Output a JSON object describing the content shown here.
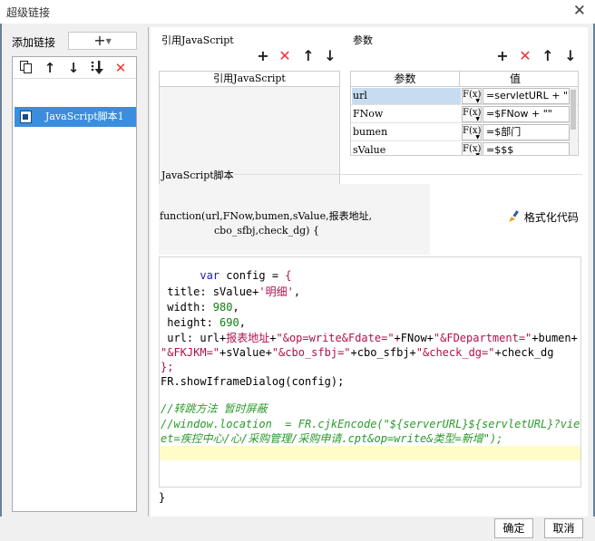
{
  "window": {
    "title": "超级链接",
    "close_glyph": "✕"
  },
  "left": {
    "add_link_label": "添加链接",
    "add_button_glyph": "+",
    "toolbar": [
      "copy-icon",
      "arrow-up-icon",
      "arrow-down-icon",
      "sort-down-icon",
      "delete-icon"
    ],
    "items": [
      {
        "label": "JavaScript脚本1",
        "icon": "script-icon"
      }
    ]
  },
  "ref_js": {
    "section_label": "引用JavaScript",
    "column_header": "引用JavaScript"
  },
  "params": {
    "section_label": "参数",
    "columns": [
      "参数",
      "值"
    ],
    "fx_label": "F(x)",
    "rows": [
      {
        "name": "url",
        "value": "=servletURL + \"?"
      },
      {
        "name": "FNow",
        "value": "=$FNow + \"\""
      },
      {
        "name": "bumen",
        "value": "=$部门"
      },
      {
        "name": "sValue",
        "value": "=$$$"
      }
    ]
  },
  "script": {
    "section_label": "JavaScript脚本",
    "signature_line1": "function(url,FNow,bumen,sValue,报表地址,",
    "signature_line2": "cbo_sfbj,check_dg) {",
    "format_button": "格式化代码",
    "code": {
      "l1_indent": "      ",
      "l1_kw": "var",
      "l1_rest": " config = ",
      "l1_brace": "{",
      "l2_a": " title: sValue+",
      "l2_s": "'明细'",
      "l2_b": ",",
      "l3_a": " width: ",
      "l3_n": "980",
      "l3_b": ",",
      "l4_a": " height: ",
      "l4_n": "690",
      "l4_b": ",",
      "l5_a": " url: url+",
      "l5_b": "报表地址",
      "l5_c": "+",
      "l5_s1": "\"&op=write&Fdate=\"",
      "l5_d": "+FNow+",
      "l5_s2": "\"&FDepartment=\"",
      "l5_e": "+bumen+",
      "l6_s1": "\"&FKJKM=\"",
      "l6_a": "+sValue+",
      "l6_s2": "\"&cbo_sfbj=\"",
      "l6_b": "+cbo_sfbj+",
      "l6_s3": "\"&check_dg=\"",
      "l6_c": "+check_dg",
      "l7": "};",
      "l8_a": "FR.showIframeDialog",
      "l8_b": "(config);",
      "c1": "//转跳方法 暂时屏蔽",
      "c2": "//window.location  = FR.cjkEncode(\"${serverURL}${servletURL}?viewl",
      "c3": "et=疾控中心/心/采购管理/采购申请.cpt&op=write&类型=新增\");",
      "closing": "}"
    }
  },
  "footer": {
    "ok": "确定",
    "cancel": "取消"
  }
}
